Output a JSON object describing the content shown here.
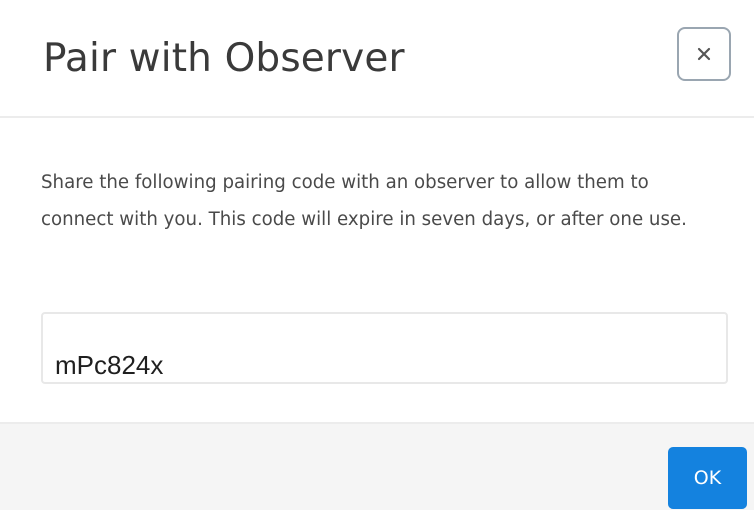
{
  "dialog": {
    "title": "Pair with Observer",
    "close_icon": "close-icon",
    "description": "Share the following pairing code with an observer to allow them to connect with you. This code will expire in seven days, or after one use.",
    "pairing_code": "mPc824x",
    "ok_label": "OK"
  },
  "colors": {
    "accent": "#1482df",
    "footer_background": "#f5f5f5",
    "title_text": "#3a3a3a"
  }
}
